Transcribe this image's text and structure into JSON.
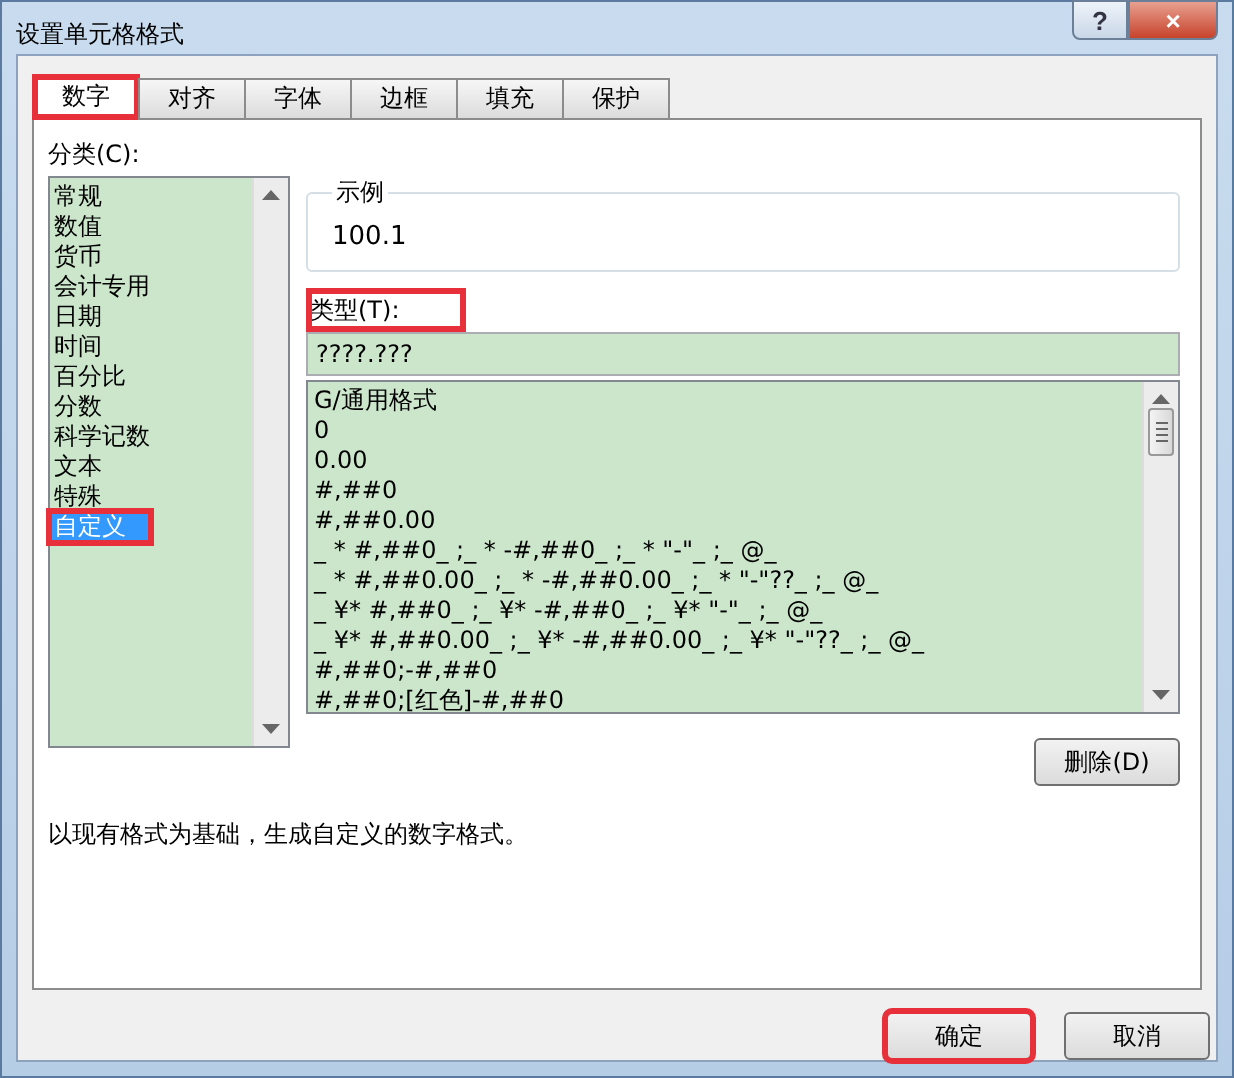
{
  "window": {
    "title": "设置单元格格式",
    "controls": [
      "?",
      "×"
    ]
  },
  "tabs": [
    {
      "label": "数字",
      "selected": true,
      "highlighted": true
    },
    {
      "label": "对齐",
      "selected": false,
      "highlighted": false
    },
    {
      "label": "字体",
      "selected": false,
      "highlighted": false
    },
    {
      "label": "边框",
      "selected": false,
      "highlighted": false
    },
    {
      "label": "填充",
      "selected": false,
      "highlighted": false
    },
    {
      "label": "保护",
      "selected": false,
      "highlighted": false
    }
  ],
  "category": {
    "label": "分类(C):",
    "items": [
      {
        "label": "常规",
        "selected": false,
        "highlighted": false
      },
      {
        "label": "数值",
        "selected": false,
        "highlighted": false
      },
      {
        "label": "货币",
        "selected": false,
        "highlighted": false
      },
      {
        "label": "会计专用",
        "selected": false,
        "highlighted": false
      },
      {
        "label": "日期",
        "selected": false,
        "highlighted": false
      },
      {
        "label": "时间",
        "selected": false,
        "highlighted": false
      },
      {
        "label": "百分比",
        "selected": false,
        "highlighted": false
      },
      {
        "label": "分数",
        "selected": false,
        "highlighted": false
      },
      {
        "label": "科学记数",
        "selected": false,
        "highlighted": false
      },
      {
        "label": "文本",
        "selected": false,
        "highlighted": false
      },
      {
        "label": "特殊",
        "selected": false,
        "highlighted": false
      },
      {
        "label": "自定义",
        "selected": true,
        "highlighted": true
      }
    ]
  },
  "sample": {
    "label": "示例",
    "value": "100.1"
  },
  "type": {
    "label": "类型(T):",
    "value": "????.???",
    "highlighted": true
  },
  "formats": [
    "G/通用格式",
    "0",
    "0.00",
    "#,##0",
    "#,##0.00",
    "_ * #,##0_ ;_ * -#,##0_ ;_ * \"-\"_ ;_ @_",
    "_ * #,##0.00_ ;_ * -#,##0.00_ ;_ * \"-\"??_ ;_ @_",
    "_ ¥* #,##0_ ;_ ¥* -#,##0_ ;_ ¥* \"-\"_ ;_ @_",
    "_ ¥* #,##0.00_ ;_ ¥* -#,##0.00_ ;_ ¥* \"-\"??_ ;_ @_",
    "#,##0;-#,##0",
    "#,##0;[红色]-#,##0"
  ],
  "delete_button": "删除(D)",
  "description": "以现有格式为基础，生成自定义的数字格式。",
  "buttons": [
    {
      "label": "确定",
      "highlighted": true
    },
    {
      "label": "取消",
      "highlighted": false
    }
  ]
}
